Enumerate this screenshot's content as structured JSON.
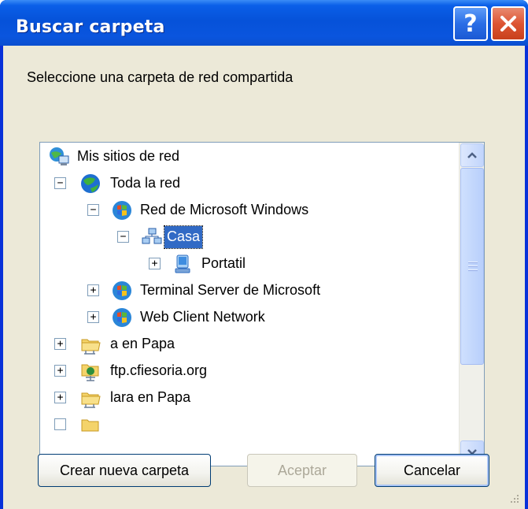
{
  "window": {
    "title": "Buscar carpeta",
    "help_label": "?",
    "close_label": "×"
  },
  "prompt": "Seleccione una carpeta de red compartida",
  "tree": {
    "items": [
      {
        "label": "Mis sitios de red",
        "icon": "network-places-icon",
        "expander": ""
      },
      {
        "label": "Toda la red",
        "icon": "globe-icon",
        "expander": "−"
      },
      {
        "label": "Red de Microsoft Windows",
        "icon": "network-icon",
        "expander": "−"
      },
      {
        "label": "Casa",
        "icon": "workgroup-icon",
        "expander": "−",
        "selected": true
      },
      {
        "label": "Portatil",
        "icon": "computer-icon",
        "expander": "+"
      },
      {
        "label": "Terminal Server de Microsoft",
        "icon": "network-icon",
        "expander": "+"
      },
      {
        "label": "Web Client Network",
        "icon": "network-icon",
        "expander": "+"
      },
      {
        "label": "a en Papa",
        "icon": "network-folder-icon",
        "expander": "+"
      },
      {
        "label": "ftp.cfiesoria.org",
        "icon": "ftp-folder-icon",
        "expander": "+"
      },
      {
        "label": "lara en Papa",
        "icon": "network-folder-icon",
        "expander": "+"
      }
    ]
  },
  "buttons": {
    "new_folder": "Crear nueva carpeta",
    "ok": "Aceptar",
    "cancel": "Cancelar"
  },
  "colors": {
    "titlebar": "#0652d9",
    "selection": "#316ac5",
    "dialog_bg": "#ece9d8"
  }
}
